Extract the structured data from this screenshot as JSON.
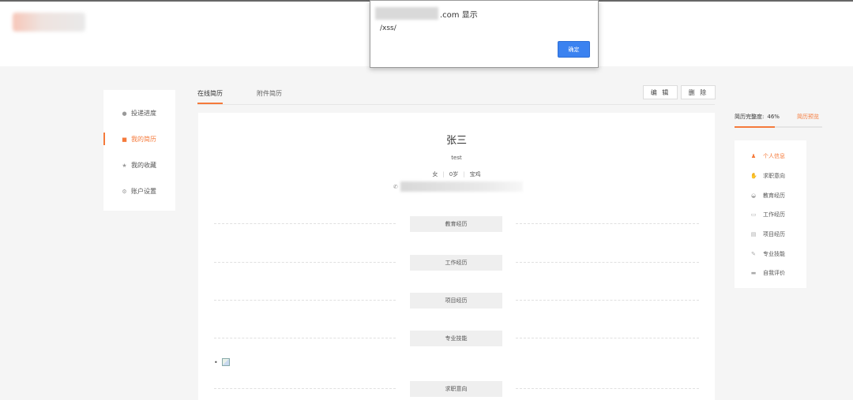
{
  "dialog": {
    "origin_suffix": ".com 显示",
    "message": "/xss/",
    "ok_label": "确定"
  },
  "left_menu": {
    "items": [
      {
        "label": "投递进度",
        "icon": "clock-icon"
      },
      {
        "label": "我的简历",
        "icon": "resume-icon",
        "active": true
      },
      {
        "label": "我的收藏",
        "icon": "star-icon"
      },
      {
        "label": "账户设置",
        "icon": "gear-icon"
      }
    ]
  },
  "tabs": [
    {
      "label": "在线简历",
      "active": true
    },
    {
      "label": "附件简历"
    }
  ],
  "toolbar": {
    "edit_label": "编 辑",
    "delete_label": "删 除"
  },
  "resume": {
    "name": "张三",
    "subtitle": "test",
    "gender": "女",
    "age": "0岁",
    "location": "宝鸡",
    "phone_icon": "phone-icon",
    "sections": [
      "教育经历",
      "工作经历",
      "项目经历",
      "专业技能",
      "求职意向"
    ],
    "bullet": "•"
  },
  "sidebar": {
    "completeness_label": "简历完整度:",
    "completeness_value": "46%",
    "completeness_fraction": 0.46,
    "preview_label": "简历预览",
    "items": [
      {
        "label": "个人信息",
        "icon": "user-icon",
        "active": true
      },
      {
        "label": "求职意向",
        "icon": "hand-icon"
      },
      {
        "label": "教育经历",
        "icon": "cap-icon"
      },
      {
        "label": "工作经历",
        "icon": "briefcase-icon"
      },
      {
        "label": "项目经历",
        "icon": "document-icon"
      },
      {
        "label": "专业技能",
        "icon": "wrench-icon"
      },
      {
        "label": "自我评价",
        "icon": "comment-icon"
      }
    ]
  },
  "colors": {
    "accent": "#f57a3b",
    "dialog_button": "#3b82f0"
  }
}
